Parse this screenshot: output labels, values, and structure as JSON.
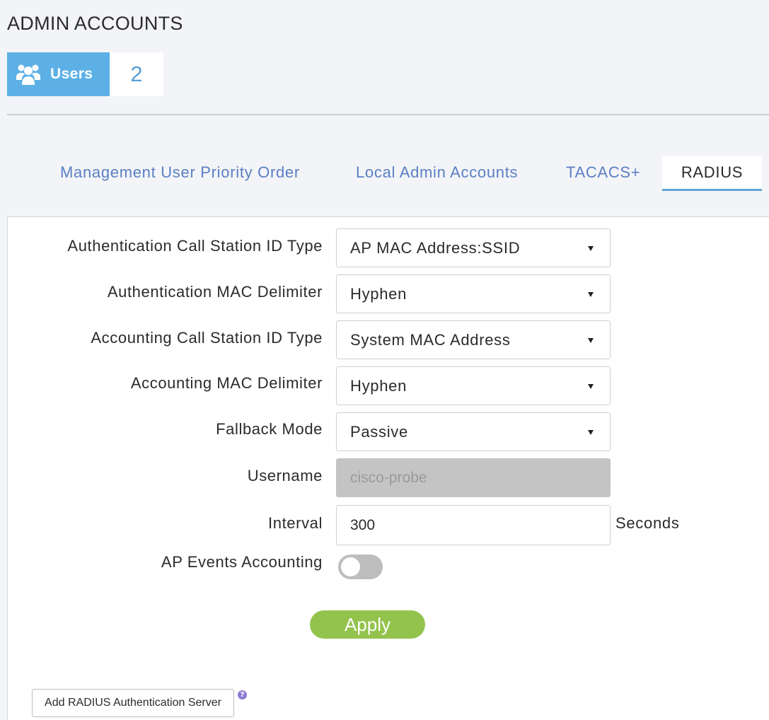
{
  "page": {
    "title": "ADMIN ACCOUNTS"
  },
  "users_badge": {
    "icon": "users-icon",
    "label": "Users",
    "count": "2",
    "color": "#5cb0e6"
  },
  "tabs": [
    {
      "label": "Management User Priority Order",
      "active": false
    },
    {
      "label": "Local Admin Accounts",
      "active": false
    },
    {
      "label": "TACACS+",
      "active": false
    },
    {
      "label": "RADIUS",
      "active": true
    }
  ],
  "form": {
    "auth_call_station_id_type": {
      "label": "Authentication Call Station ID Type",
      "value": "AP MAC Address:SSID"
    },
    "auth_mac_delimiter": {
      "label": "Authentication MAC Delimiter",
      "value": "Hyphen"
    },
    "acct_call_station_id_type": {
      "label": "Accounting Call Station ID Type",
      "value": "System MAC Address"
    },
    "acct_mac_delimiter": {
      "label": "Accounting MAC Delimiter",
      "value": "Hyphen"
    },
    "fallback_mode": {
      "label": "Fallback Mode",
      "value": "Passive"
    },
    "username": {
      "label": "Username",
      "value": "cisco-probe",
      "disabled": true
    },
    "interval": {
      "label": "Interval",
      "value": "300",
      "unit": "Seconds"
    },
    "ap_events_accounting": {
      "label": "AP Events Accounting",
      "enabled": false
    }
  },
  "buttons": {
    "apply": "Apply",
    "add_radius_auth_server": "Add RADIUS Authentication Server"
  },
  "help_icon": {
    "icon": "question-circle-icon",
    "glyph": "?"
  },
  "colors": {
    "accent_blue": "#5ea6de",
    "tab_link": "#5a7fc4",
    "apply_green": "#93c34d"
  }
}
